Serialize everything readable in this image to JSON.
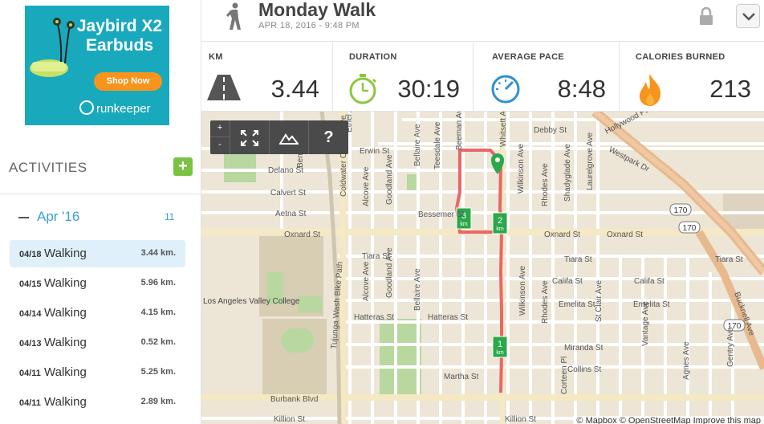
{
  "ad": {
    "title": "Jaybird X2 Earbuds",
    "button": "Shop Now",
    "brand": "runkeeper"
  },
  "sidebar": {
    "heading": "ACTIVITIES",
    "add_label": "+",
    "month": {
      "label": "Apr '16",
      "count": "11"
    },
    "activities": [
      {
        "date": "04/18",
        "type": "Walking",
        "distance": "3.44 km.",
        "selected": true
      },
      {
        "date": "04/15",
        "type": "Walking",
        "distance": "5.96 km."
      },
      {
        "date": "04/14",
        "type": "Walking",
        "distance": "4.15 km."
      },
      {
        "date": "04/13",
        "type": "Walking",
        "distance": "0.52 km."
      },
      {
        "date": "04/11",
        "type": "Walking",
        "distance": "5.25 km."
      },
      {
        "date": "04/11",
        "type": "Walking",
        "distance": "2.89 km."
      }
    ]
  },
  "header": {
    "title": "Monday Walk",
    "subtitle": "APR 18, 2016  -  9:48 PM"
  },
  "stats": [
    {
      "label": "KM",
      "value": "3.44",
      "icon": "road-icon"
    },
    {
      "label": "DURATION",
      "value": "30:19",
      "icon": "stopwatch-icon"
    },
    {
      "label": "AVERAGE PACE",
      "value": "8:48",
      "icon": "speedometer-icon"
    },
    {
      "label": "CALORIES BURNED",
      "value": "213",
      "icon": "flame-icon"
    }
  ],
  "map": {
    "controls": {
      "zoom_in": "+",
      "zoom_out": "-",
      "help": "?"
    },
    "streets": [
      "Debby St",
      "Erwin St",
      "Delano St",
      "Calvert St",
      "Aetna St",
      "Bessemer St",
      "Oxnard St",
      "Tiara St",
      "Califa St",
      "Emelita St",
      "Hatteras St",
      "Miranda St",
      "Collins St",
      "Martha St",
      "Burbank Blvd",
      "Killion St",
      "Hollywood Fwy",
      "Westpark Dr",
      "Bellaire Ave",
      "Beeman Ave",
      "Whitsett Ave",
      "Wilkinson Ave",
      "Rhodes Ave",
      "Shadyglade Ave",
      "Laurelgrove Ave",
      "Teesdale Ave",
      "Goodland Ave",
      "Alcove Ave",
      "Coldwater Canyon Ave",
      "Tujunga Wash Bike Path",
      "St Clair Ave",
      "Vantage Ave",
      "Agnes Ave",
      "Gentry Ave",
      "Bucknell Ave",
      "Corteen Pl",
      "Ethel Ave",
      "Ben Ave"
    ],
    "poi": "Los Angeles Valley College",
    "highway_shield": "170",
    "km_markers": [
      "1",
      "2",
      "3"
    ],
    "km_unit": "km",
    "attribution": "© Mapbox © OpenStreetMap Improve this map"
  }
}
